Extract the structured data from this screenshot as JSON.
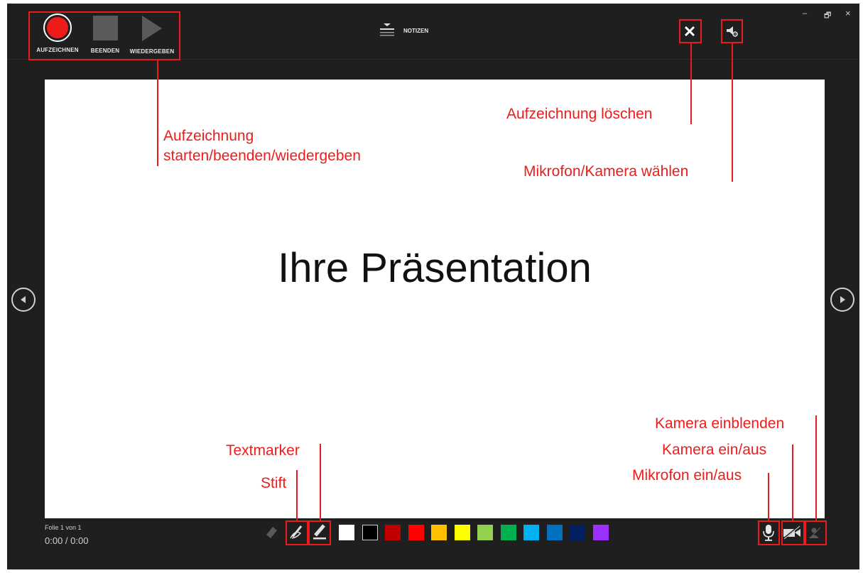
{
  "toolbar": {
    "record_label": "AUFZEICHNEN",
    "stop_label": "BEENDEN",
    "play_label": "WIEDERGEBEN",
    "notes_label": "NOTIZEN"
  },
  "window_controls": {
    "minimize": "–",
    "restore": "🗗",
    "close": "×"
  },
  "slide": {
    "title": "Ihre Präsentation"
  },
  "status": {
    "slide_counter": "Folie 1 von 1",
    "time": "0:00 / 0:00"
  },
  "colors": {
    "accent_record": "#ee1b1b",
    "annotation": "#e81c1c",
    "swatches": [
      "#ffffff",
      "#000000",
      "#c00000",
      "#ff0000",
      "#ffc000",
      "#ffff00",
      "#92d050",
      "#00b050",
      "#00b0f0",
      "#0070c0",
      "#002060",
      "#9b30ff"
    ]
  },
  "annotations": {
    "record_controls": "Aufzeichnung\nstarten/beenden/wiedergeben",
    "delete_recording": "Aufzeichnung löschen",
    "choose_mic_camera": "Mikrofon/Kamera wählen",
    "highlighter": "Textmarker",
    "pen": "Stift",
    "show_camera": "Kamera einblenden",
    "camera_toggle": "Kamera ein/aus",
    "mic_toggle": "Mikrofon ein/aus"
  }
}
